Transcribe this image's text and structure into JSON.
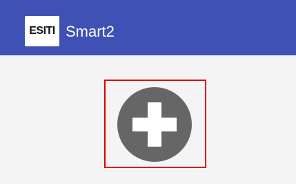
{
  "app": {
    "logo_text": "ESITI",
    "title": "Smart2"
  },
  "main": {
    "add_button": {
      "icon": "plus-circle-icon",
      "highlighted": true,
      "highlight_color": "#e00000",
      "icon_color": "#666666"
    }
  },
  "colors": {
    "appbar": "#3f51b5",
    "background": "#f4f4f4"
  }
}
